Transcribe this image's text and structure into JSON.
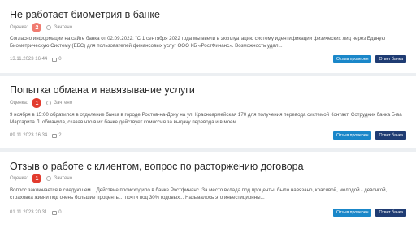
{
  "reviews": [
    {
      "title": "Не работает биометрия в банке",
      "rating_label": "Оценка:",
      "rating": "2",
      "status": "Зачтено",
      "text": "Согласно информации на сайте банка от 02.09.2022: \"С 1 сентября 2022 года мы ввели в эксплуатацию систему идентификации физических лиц через Единую Биометрическую Систему (ЕБС) для пользователей финансовых услуг ООО КБ «РостФинанс». Возможность удал...",
      "date": "13.11.2023 16:44",
      "comments": "0",
      "review_button": "Отзыв проверен",
      "answer_button": "Ответ банка"
    },
    {
      "title": "Попытка обмана и навязывание услуги",
      "rating_label": "Оценка:",
      "rating": "1",
      "status": "Зачтено",
      "text": "9 ноября в 15:00 обратился в отделение банка в городе Ростов-на-Дону на ул. Красноармейская 170 для получения перевода системой Контакт. Сотрудник банка Б-ва Маргарита Л. обманула, сказав что в их банке действует комиссия за выдачу перевода и в моем ...",
      "date": "09.11.2023 16:34",
      "comments": "2",
      "review_button": "Отзыв проверен",
      "answer_button": "Ответ банка"
    },
    {
      "title": "Отзыв о работе с клиентом, вопрос по расторжению договора",
      "rating_label": "Оценка:",
      "rating": "1",
      "status": "Зачтено",
      "text": "Вопрос заключается в следующем... Действие происходило в банке Ростфинанс. За место вклада под проценты, было навязано, красивой, молодой - девочкой, страховка жизни под очень большие проценты... почти под 30% годовых... Называлось это инвестиционны...",
      "date": "01.11.2023 20:31",
      "comments": "0",
      "review_button": "Отзыв проверен",
      "answer_button": "Ответ банка"
    }
  ]
}
